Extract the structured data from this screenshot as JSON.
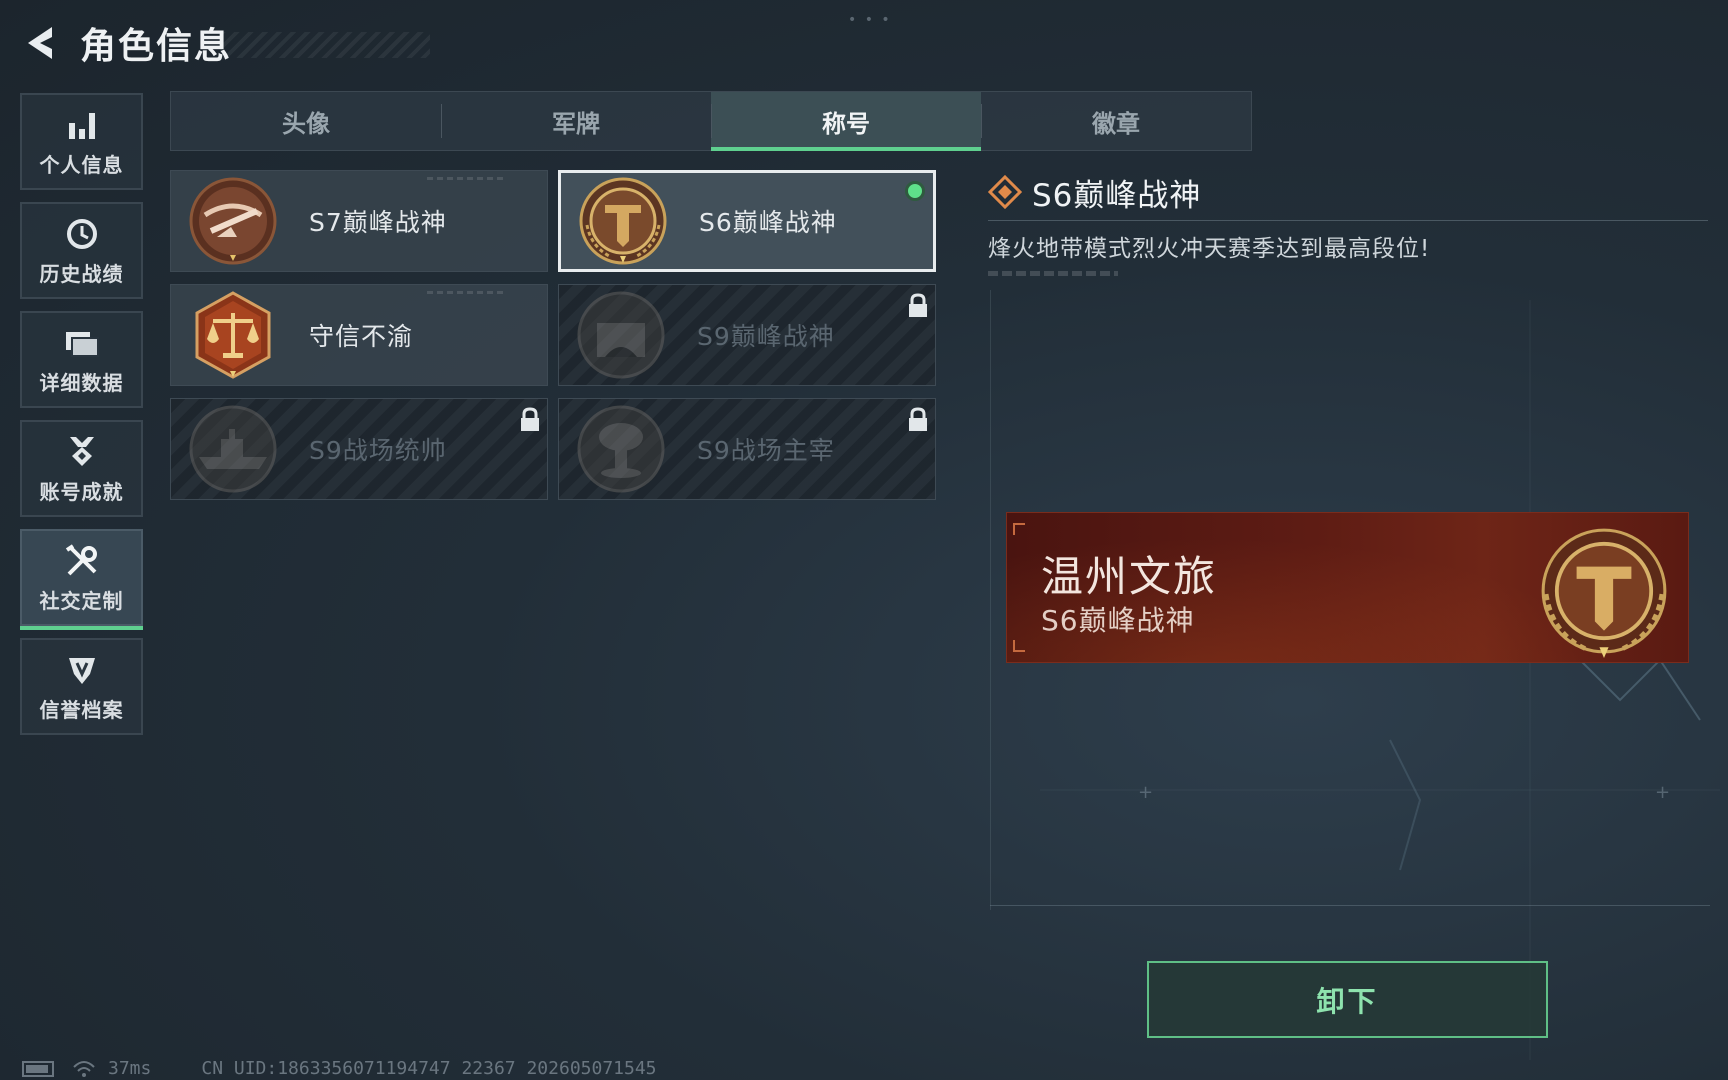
{
  "header": {
    "title": "角色信息"
  },
  "sidebar": {
    "items": [
      {
        "label": "个人信息",
        "icon": "bar-chart-icon"
      },
      {
        "label": "历史战绩",
        "icon": "clock-history-icon"
      },
      {
        "label": "详细数据",
        "icon": "folder-icon"
      },
      {
        "label": "账号成就",
        "icon": "medal-icon"
      },
      {
        "label": "社交定制",
        "icon": "tools-icon",
        "active": true
      },
      {
        "label": "信誉档案",
        "icon": "shield-badge-icon"
      }
    ]
  },
  "tabs": [
    {
      "label": "头像"
    },
    {
      "label": "军牌"
    },
    {
      "label": "称号",
      "active": true
    },
    {
      "label": "徽章"
    }
  ],
  "titles": [
    {
      "name": "S7巅峰战神",
      "emblem": "crossbow-emblem-icon",
      "locked": false,
      "selected": false
    },
    {
      "name": "S6巅峰战神",
      "emblem": "t-laurel-emblem-icon",
      "locked": false,
      "selected": true,
      "equipped": true
    },
    {
      "name": "守信不渝",
      "emblem": "scales-emblem-icon",
      "locked": false,
      "selected": false
    },
    {
      "name": "S9巅峰战神",
      "emblem": "bunker-emblem-icon",
      "locked": true,
      "selected": false
    },
    {
      "name": "S9战场统帅",
      "emblem": "warship-emblem-icon",
      "locked": true,
      "selected": false
    },
    {
      "name": "S9战场主宰",
      "emblem": "mushroom-cloud-emblem-icon",
      "locked": true,
      "selected": false
    }
  ],
  "detail": {
    "title": "S6巅峰战神",
    "description": "烽火地带模式烈火冲天赛季达到最高段位!"
  },
  "preview": {
    "player_name": "温州文旅",
    "title": "S6巅峰战神"
  },
  "actions": {
    "unequip_label": "卸下"
  },
  "status": {
    "ping": "37ms",
    "uid": "CN UID:1863356071194747 22367 202605071545"
  },
  "colors": {
    "accent_green": "#5fd08f",
    "banner_red": "#5e1c14",
    "emblem_gold": "#c9a25a",
    "emblem_brown": "#6b3a22"
  }
}
